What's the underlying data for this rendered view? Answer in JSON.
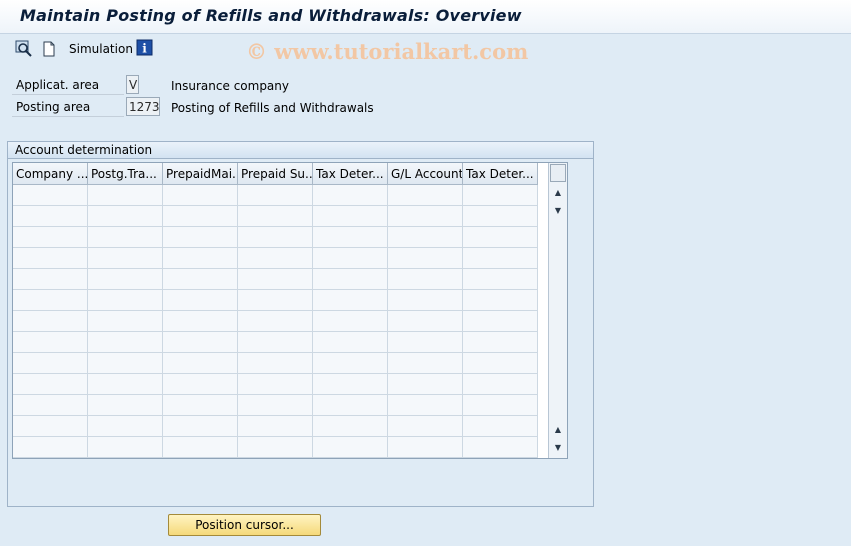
{
  "title": "Maintain Posting of Refills and Withdrawals: Overview",
  "toolbar": {
    "simulation_label": "Simulation",
    "icons": [
      "display-icon",
      "new-document-icon",
      "info-icon"
    ]
  },
  "watermark": "© www.tutorialkart.com",
  "fields": [
    {
      "label": "Applicat. area",
      "value": "V",
      "description": "Insurance company"
    },
    {
      "label": "Posting area",
      "value": "1273",
      "description": "Posting of Refills and Withdrawals"
    }
  ],
  "group": {
    "title": "Account determination"
  },
  "table": {
    "columns": [
      "Company ...",
      "Postg.Tra...",
      "PrepaidMai...",
      "Prepaid Su...",
      "Tax Deter...",
      "G/L Account",
      "Tax Deter..."
    ],
    "row_count": 13
  },
  "position_button": "Position cursor..."
}
